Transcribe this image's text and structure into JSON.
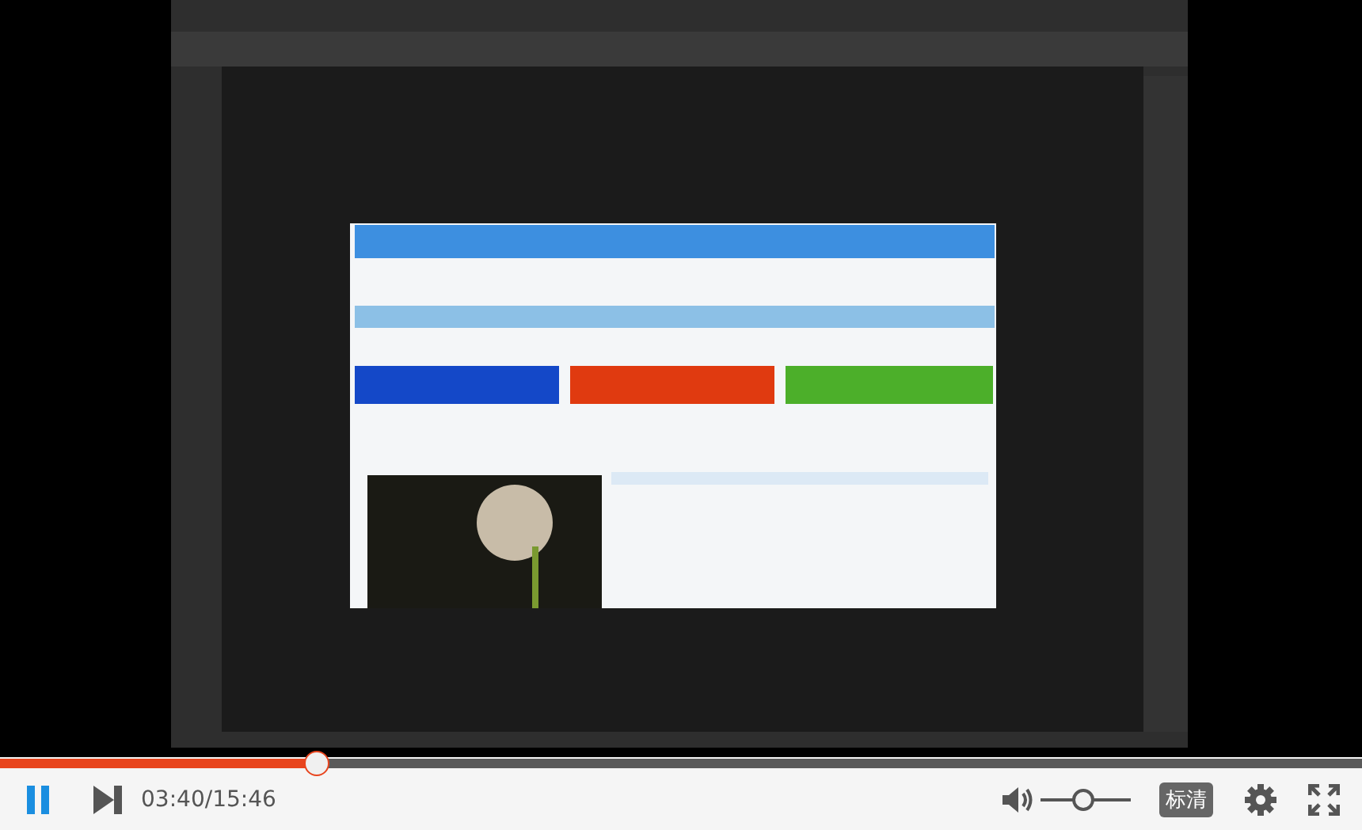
{
  "progress": {
    "level": 0.233
  },
  "controls": {
    "playing": true,
    "time": "03:40/15:46",
    "volume": {
      "level": 0.47
    },
    "quality_button": "标清"
  }
}
